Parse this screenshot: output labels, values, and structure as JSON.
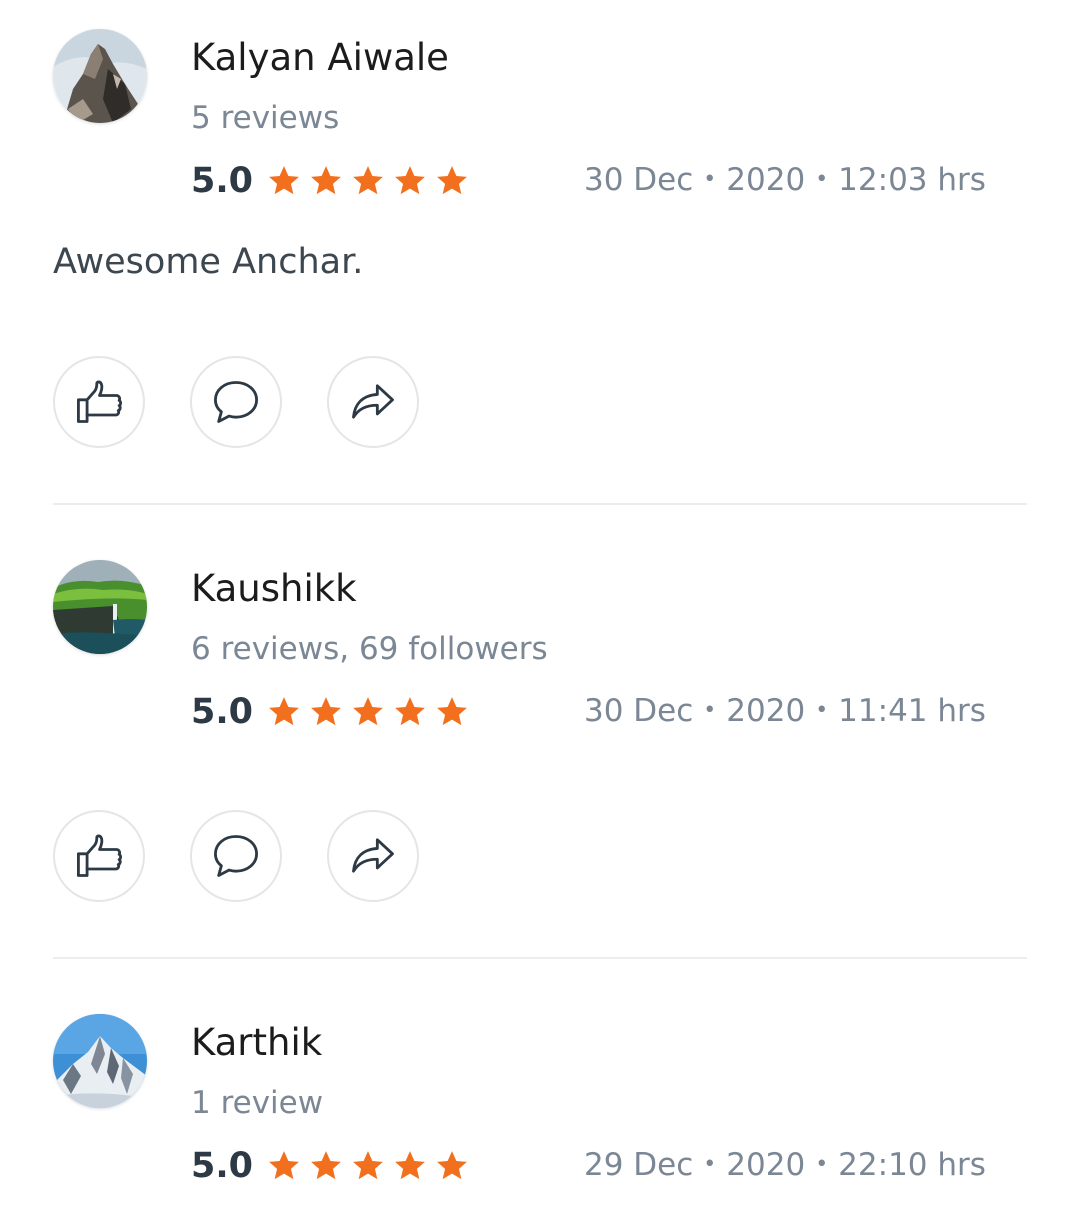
{
  "reviews": [
    {
      "name": "Kalyan Aiwale",
      "meta": "5 reviews",
      "rating": "5.0",
      "stars": 5,
      "date": "30 Dec",
      "year": "2020",
      "time": "12:03 hrs",
      "text": "Awesome Anchar.",
      "avatar_icon": "rocky-peak-avatar"
    },
    {
      "name": "Kaushikk",
      "meta": "6 reviews, 69 followers",
      "rating": "5.0",
      "stars": 5,
      "date": "30 Dec",
      "year": "2020",
      "time": "11:41 hrs",
      "text": "",
      "avatar_icon": "green-cliff-avatar"
    },
    {
      "name": "Karthik",
      "meta": "1 review",
      "rating": "5.0",
      "stars": 5,
      "date": "29 Dec",
      "year": "2020",
      "time": "22:10 hrs",
      "text": "",
      "avatar_icon": "snow-mountain-avatar"
    }
  ],
  "actions": {
    "like_icon": "thumbs-up-icon",
    "comment_icon": "comment-icon",
    "share_icon": "share-icon"
  },
  "colors": {
    "star": "#f26f1d",
    "rating_text": "#2d3a45",
    "meta_text": "#7b8794",
    "divider": "#ebedf0"
  }
}
